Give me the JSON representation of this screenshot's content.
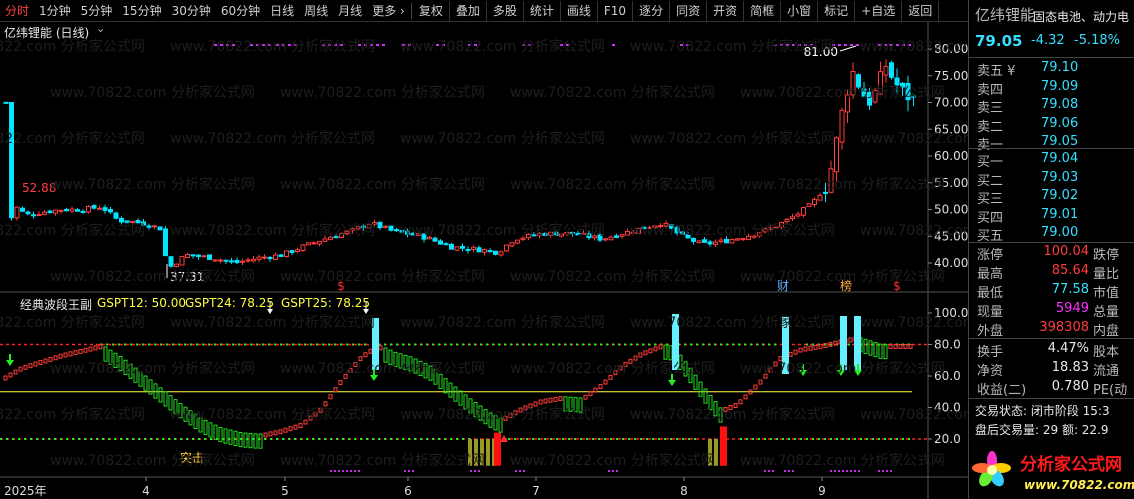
{
  "toolbar": {
    "items": [
      "分时",
      "1分钟",
      "5分钟",
      "15分钟",
      "30分钟",
      "60分钟",
      "日线",
      "周线",
      "月线",
      "更多 ›"
    ],
    "buttons": [
      "复权",
      "叠加",
      "多股",
      "统计",
      "画线",
      "F10",
      "逐分",
      "同资",
      "开资",
      "简框",
      "小窗",
      "标记",
      "+自选",
      "返回"
    ]
  },
  "main_chart": {
    "title": "亿纬锂能 (日线)",
    "high_label": "81.00",
    "low_label": "37.31",
    "early_high_label": "52.88",
    "y_ticks": [
      "80.00",
      "75.00",
      "70.00",
      "65.00",
      "60.00",
      "55.00",
      "50.00",
      "45.00",
      "40.00"
    ],
    "markers": [
      "$",
      "财",
      "榜",
      "$"
    ]
  },
  "indicator": {
    "name": "经典波段王副",
    "gspt12": "GSPT12: 50.00",
    "gspt24": "GSPT24: 78.25",
    "gspt25": "GSPT25: 78.25",
    "y_ticks": [
      "100.0",
      "80.0",
      "60.0",
      "40.0",
      "20.0"
    ],
    "note_label": "突击"
  },
  "x_axis": {
    "labels": [
      "2025年",
      "4",
      "5",
      "6",
      "7",
      "8",
      "9"
    ]
  },
  "watermark": "www.70822.com 分析家公式网",
  "quote": {
    "name": "亿纬锂能",
    "concept": "固态电池、动力电",
    "price": "79.05",
    "change": "-4.32",
    "change_pct": "-5.18%",
    "asks": [
      {
        "label": "卖五 ¥",
        "price": "79.10"
      },
      {
        "label": "卖四",
        "price": "79.09"
      },
      {
        "label": "卖三",
        "price": "79.08"
      },
      {
        "label": "卖二",
        "price": "79.06"
      },
      {
        "label": "卖一",
        "price": "79.05"
      }
    ],
    "bids": [
      {
        "label": "买一",
        "price": "79.04"
      },
      {
        "label": "买二",
        "price": "79.03"
      },
      {
        "label": "买三",
        "price": "79.02"
      },
      {
        "label": "买四",
        "price": "79.01"
      },
      {
        "label": "买五",
        "price": "79.00"
      }
    ],
    "stats1": [
      {
        "label": "涨停",
        "value": "100.04",
        "label2": "跌停"
      },
      {
        "label": "最高",
        "value": "85.64",
        "label2": "量比"
      },
      {
        "label": "最低",
        "value": "77.58",
        "label2": "市值"
      },
      {
        "label": "现量",
        "value": "5949",
        "label2": "总量"
      },
      {
        "label": "外盘",
        "value": "398308",
        "label2": "内盘"
      }
    ],
    "stats2": [
      {
        "label": "换手",
        "value": "4.47%",
        "label2": "股本"
      },
      {
        "label": "净资",
        "value": "18.83",
        "label2": "流通"
      },
      {
        "label": "收益(二)",
        "value": "0.780",
        "label2": "PE(动"
      }
    ],
    "trade_status": "交易状态: 闭市阶段 15:3",
    "after_hours": "盘后交易量: 29  额: 22.9"
  },
  "brand": {
    "name": "分析家公式网",
    "url": "www.70822.com"
  },
  "colors": {
    "up": "#ff3b3b",
    "down": "#00e5ff",
    "indicator_down": "#22dd22",
    "red_dash": "#ff2020",
    "green_dash": "#22ee22",
    "yellow_line": "#ffff40",
    "signal_bar": "#66f0ff"
  }
}
